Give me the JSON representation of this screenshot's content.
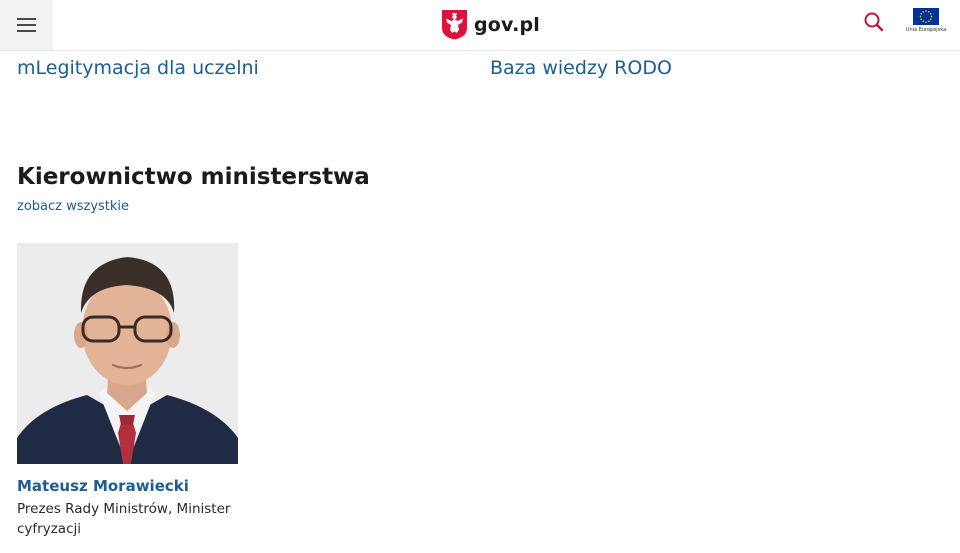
{
  "header": {
    "site_name": "gov.pl",
    "eu_label": "Unia Europejska",
    "icons": [
      "menu-icon",
      "polish-eagle-emblem",
      "search-icon",
      "eu-flag-icon"
    ]
  },
  "links": {
    "left": "mLegitymacja dla uczelni",
    "right": "Baza wiedzy RODO"
  },
  "leadership": {
    "title": "Kierownictwo ministerstwa",
    "see_all": "zobacz wszystkie",
    "people": [
      {
        "name": "Mateusz Morawiecki",
        "role": "Prezes Rady Ministrów, Minister cyfryzacji"
      }
    ]
  },
  "colors": {
    "link": "#1d5d90",
    "emblem_red": "#dc143c",
    "eu_blue": "#003399",
    "eu_star": "#ffcc00"
  }
}
